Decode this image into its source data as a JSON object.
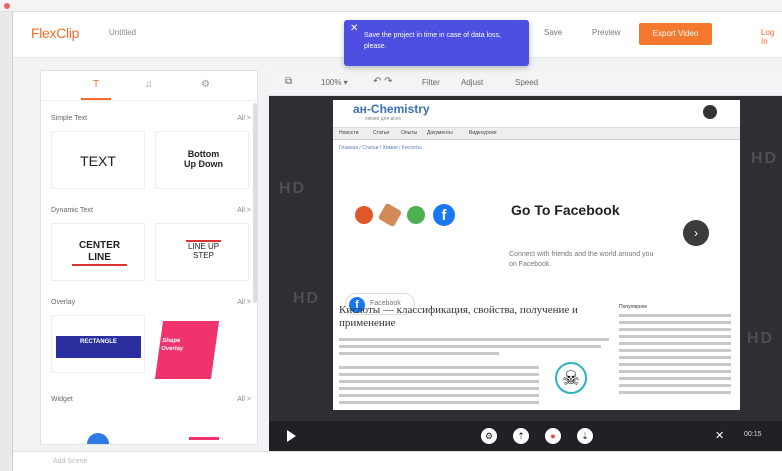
{
  "app": {
    "logo": "FlexClip",
    "project_name": "Untitled",
    "nav": {
      "save": "Save",
      "preview": "Preview",
      "export": "Export Video",
      "login": "Log In"
    }
  },
  "toast": {
    "message": "Save the project in time in case of data loss, please."
  },
  "sidebar": {
    "tabs": [
      "T",
      "♫",
      "⚙"
    ],
    "sections": [
      {
        "title": "Simple Text",
        "all": "All >",
        "cards": [
          "TEXT",
          "Bottom Up Down"
        ]
      },
      {
        "title": "Dynamic Text",
        "all": "All >",
        "cards": [
          "CENTER LINE",
          "LINE UP STEP"
        ]
      },
      {
        "title": "Overlay",
        "all": "All >",
        "cards": [
          "RECTANGLE",
          "Shape Overlay"
        ]
      },
      {
        "title": "Widget",
        "all": "All >",
        "cards": []
      }
    ]
  },
  "canvas_toolbar": {
    "zoom": "100% ▾",
    "undo_redo": "↶ ↷",
    "filter": "Filter",
    "adjust": "Adjust",
    "speed": "Speed"
  },
  "webpage": {
    "site_logo": "ан-Chemistry",
    "site_subtitle": "химия для всех",
    "nav_items": [
      "Новости",
      "Статьи",
      "Опыты",
      "Документы",
      "Видеоуроки"
    ],
    "breadcrumbs": "Главная / Статьи / Химия / Кислоты",
    "ad_title": "Go To Facebook",
    "ad_desc": "Connect with friends and the world around you on Facebook.",
    "fb_label": "Facebook",
    "article_title": "Кислоты — классификация, свойства, получение и применение",
    "side_title": "Популярное"
  },
  "player": {
    "time": "00:15"
  },
  "bottom": {
    "text": "Add Scene"
  },
  "colors": {
    "accent": "#f26d28",
    "toast": "#4c4fe0",
    "stage": "#2d2f33"
  }
}
